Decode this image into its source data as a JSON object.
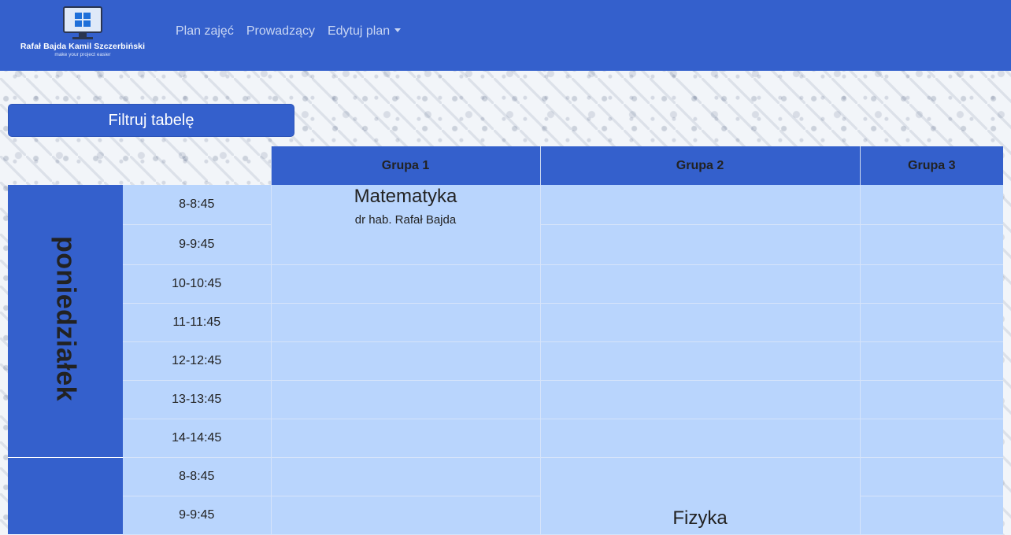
{
  "brand": {
    "name": "Rafał Bajda Kamil Szczerbiński",
    "tagline": "make your project easier"
  },
  "nav": {
    "items": [
      {
        "label": "Plan zajęć"
      },
      {
        "label": "Prowadzący"
      },
      {
        "label": "Edytuj plan"
      }
    ]
  },
  "filter_button": {
    "label": "Filtruj tabelę"
  },
  "table": {
    "groups": [
      "Grupa 1",
      "Grupa 2",
      "Grupa 3"
    ],
    "days": [
      {
        "name": "poniedziałek",
        "times": [
          "8-8:45",
          "9-9:45",
          "10-10:45",
          "11-11:45",
          "12-12:45",
          "13-13:45",
          "14-14:45"
        ],
        "lesson": {
          "subject": "Matematyka",
          "teacher": "dr hab. Rafał Bajda",
          "group": "Grupa 1"
        }
      },
      {
        "name": "",
        "times": [
          "8-8:45",
          "9-9:45"
        ],
        "lesson": {
          "subject": "Fizyka",
          "group": "Grupa 2"
        }
      }
    ]
  },
  "colors": {
    "primary": "#3460cc",
    "cell": "#b9d5fd"
  }
}
